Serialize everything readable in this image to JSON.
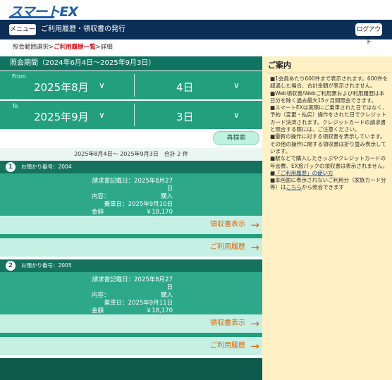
{
  "logo": "スマートEX",
  "header": {
    "menu_label": "メニュー",
    "title": "ご利用履歴・領収書の発行",
    "logout_label": "ログアウト"
  },
  "breadcrumb": {
    "step1": "照会範囲選択",
    "sep1": ">",
    "step2": "ご利用履歴一覧",
    "sep2": ">",
    "step3": "詳細"
  },
  "period": {
    "label": "照会期間（2024年6月4日～2025年9月3日）",
    "from_label": "From",
    "from_month": "2025年8月",
    "from_day": "4日",
    "to_label": "To",
    "to_month": "2025年9月",
    "to_day": "3日",
    "chevron": "∨"
  },
  "search_button": "再検索",
  "summary": "2025年8月4日～ 2025年9月3日　合計 2 件",
  "records": [
    {
      "number": "1",
      "ref_label": "お預かり番号：2004",
      "issued": "請求書記載日：2025年8月27日",
      "content_label": "内容：",
      "content_value": "購入",
      "ride_date": "乗車日：2025年9月10日",
      "amount_label": "金額",
      "amount_value": "￥18,170",
      "receipt_link": "領収書表示",
      "history_link": "ご利用履歴"
    },
    {
      "number": "2",
      "ref_label": "お預かり番号：2005",
      "issued": "請求書記載日：2025年8月27日",
      "content_label": "内容：",
      "content_value": "購入",
      "ride_date": "乗車日：2025年9月11日",
      "amount_label": "金額",
      "amount_value": "￥18,170",
      "receipt_link": "領収書表示",
      "history_link": "ご利用履歴"
    }
  ],
  "arrow": "→",
  "info": {
    "title": "ご案内",
    "p1": "■1会員あたり600件まで表示されます。600件を超過した場合、合計金額が表示されません。",
    "p2": "■Web領収書/Webご利用票および利用履歴は本日分を除く過去最大15ヶ月間照会できます。",
    "p3": "■スマートEXは実際にご乗車された日ではなく、予約（変更・払戻）操作をされた日でクレジットカード決済されます。クレジットカードの請求書と照合する際には、ご注意ください。",
    "p4": "■最新の操作に対する領収書を表示しています。その他の操作に関する領収書は折り畳み表示しています。",
    "p5": "■駅などで購入したきっぷやクレジットカードの年会費、EX旅パックの領収書は表示されません。",
    "p6_prefix": "■",
    "p6_link": "「ご利用履歴」の使い方",
    "p7_text": "■本画面に表示されないご利用分（家族カード分等）は",
    "p7_link": "こちら",
    "p7_suffix": "から照会できます"
  },
  "colors": {
    "header": "#0b2f57",
    "accent_green": "#22a07e",
    "link_orange": "#e06500",
    "info_bg": "#fff1c5"
  }
}
